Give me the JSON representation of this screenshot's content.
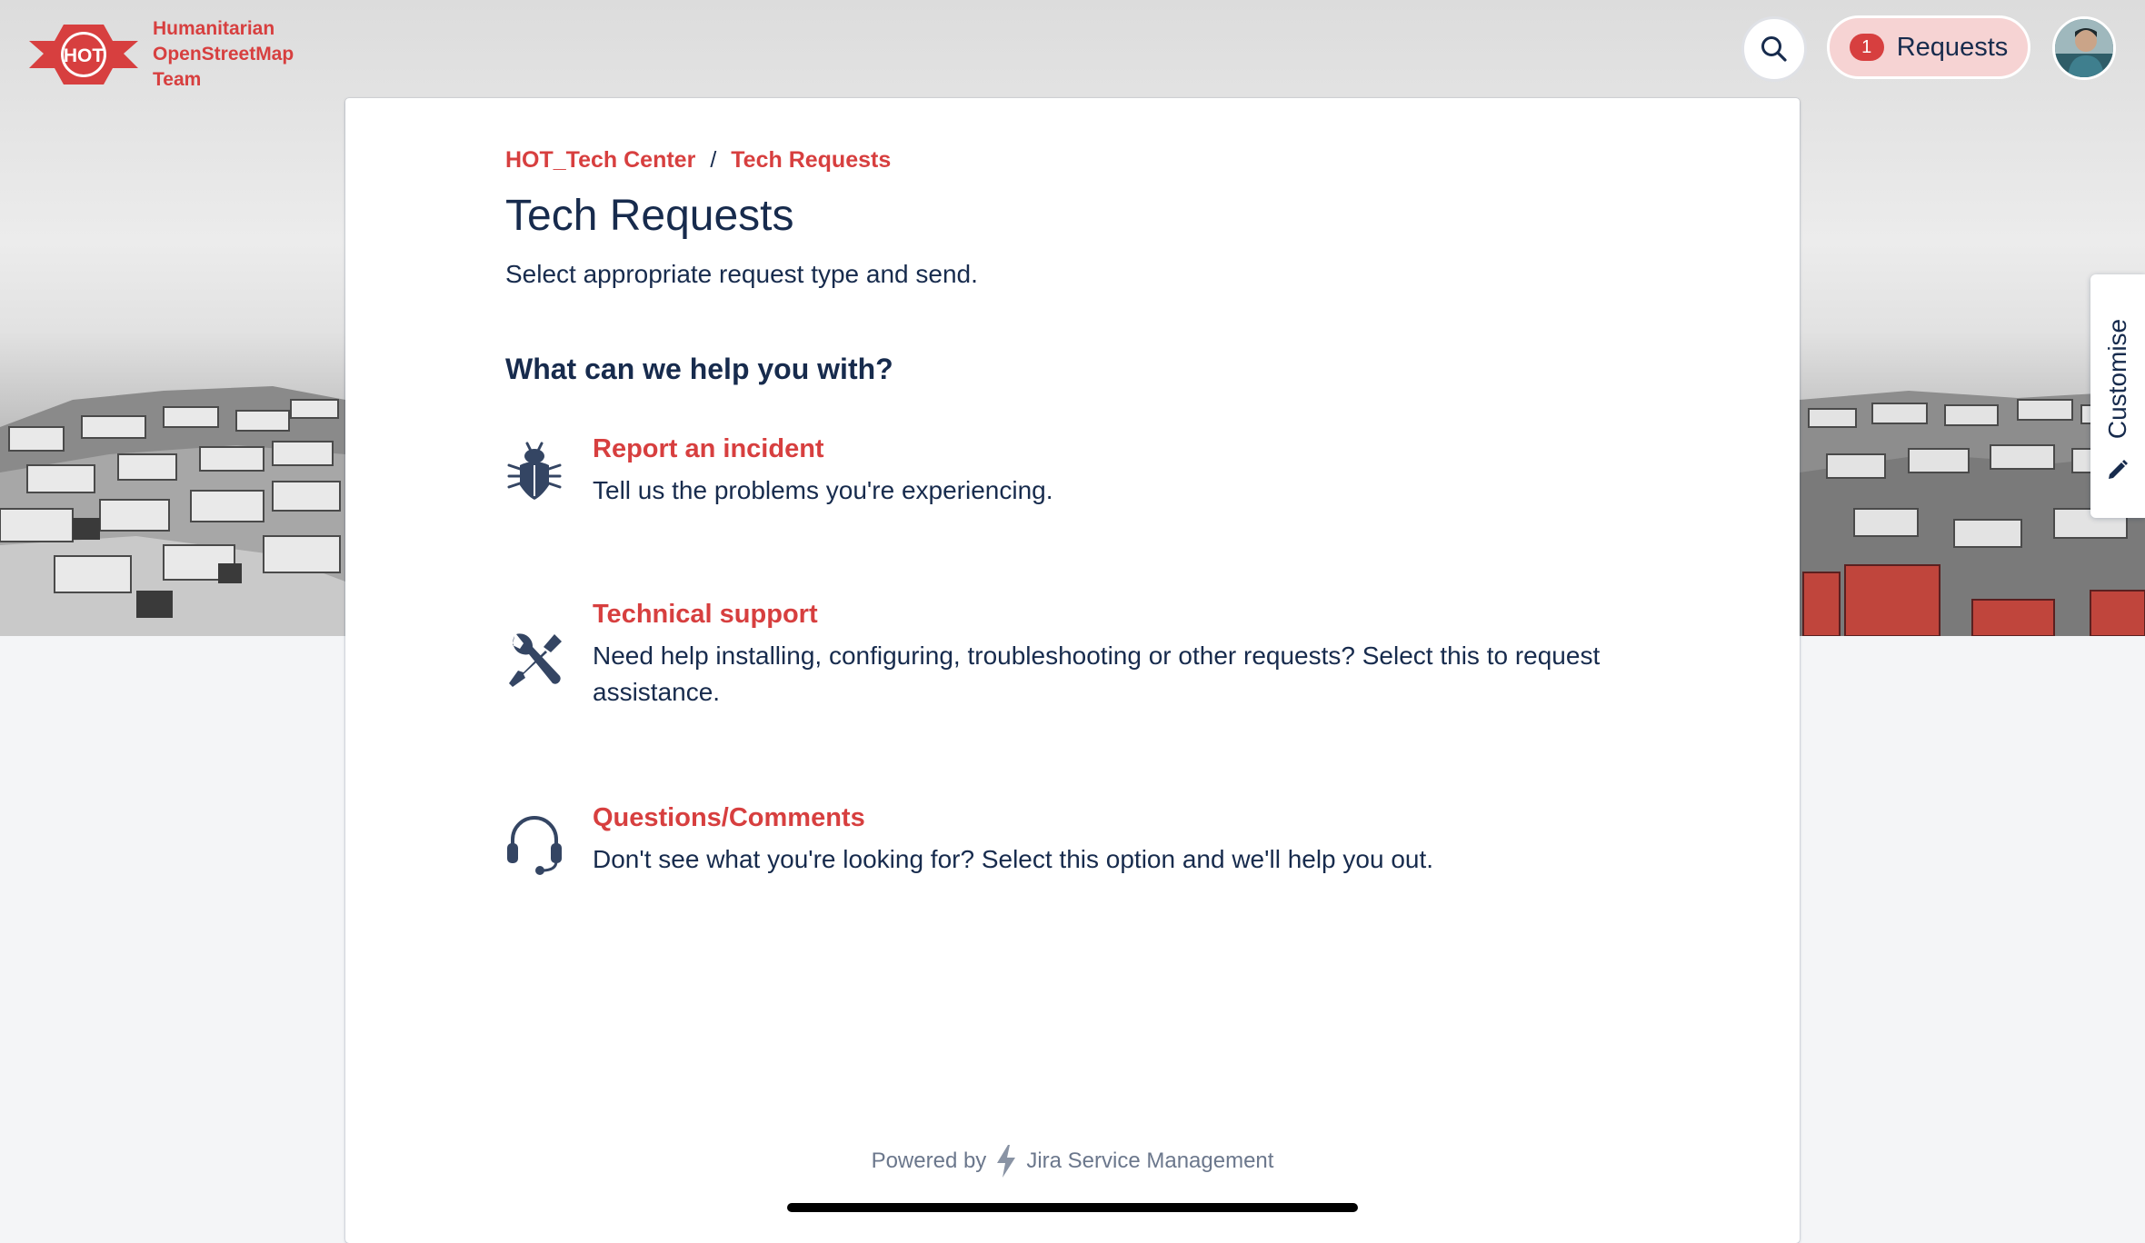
{
  "brand": {
    "logo_mark": "HOT",
    "name_lines": [
      "Humanitarian",
      "OpenStreetMap",
      "Team"
    ],
    "primary_color": "#d73f3f"
  },
  "header": {
    "search_icon": "search-icon",
    "requests": {
      "count": "1",
      "label": "Requests"
    },
    "avatar_icon": "avatar"
  },
  "customise": {
    "label": "Customise",
    "icon": "pencil-icon"
  },
  "breadcrumb": {
    "items": [
      "HOT_Tech Center",
      "Tech Requests"
    ],
    "separator": "/"
  },
  "page": {
    "title": "Tech Requests",
    "description": "Select appropriate request type and send.",
    "help_heading": "What can we help you with?"
  },
  "request_types": [
    {
      "icon": "bug-icon",
      "title": "Report an incident",
      "description": "Tell us the problems you're experiencing."
    },
    {
      "icon": "tools-icon",
      "title": "Technical support",
      "description": "Need help installing, configuring, troubleshooting or other requests? Select this to request assistance."
    },
    {
      "icon": "headset-icon",
      "title": "Questions/Comments",
      "description": "Don't see what you're looking for? Select this option and we'll help you out."
    }
  ],
  "footer": {
    "powered_by": "Powered by",
    "product": "Jira Service Management",
    "product_icon": "jira-lightning-icon"
  }
}
